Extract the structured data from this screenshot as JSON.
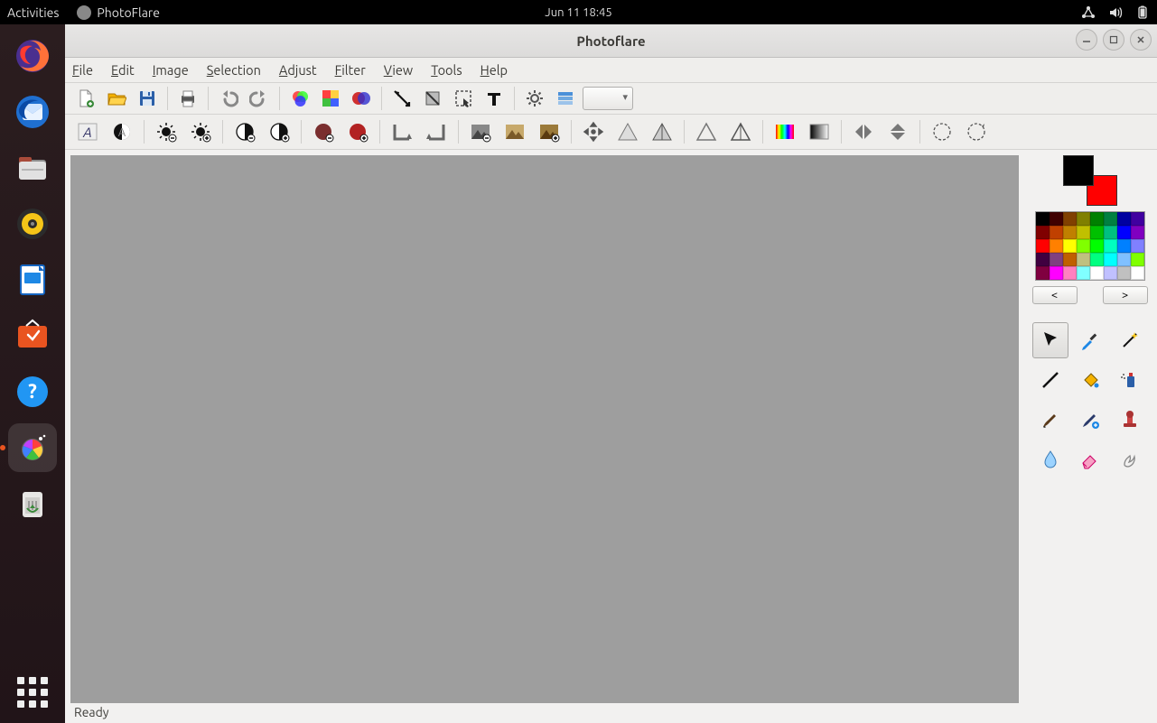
{
  "topbar": {
    "activities": "Activities",
    "app_name": "PhotoFlare",
    "clock": "Jun 11  18:45"
  },
  "window": {
    "title": "Photoflare"
  },
  "menu": {
    "file": "File",
    "edit": "Edit",
    "image": "Image",
    "selection": "Selection",
    "adjust": "Adjust",
    "filter": "Filter",
    "view": "View",
    "tools": "Tools",
    "help": "Help"
  },
  "palette_nav": {
    "prev": "<",
    "next": ">"
  },
  "palette_colors": [
    "#000000",
    "#400000",
    "#804000",
    "#808000",
    "#008000",
    "#008040",
    "#0000a0",
    "#4000a0",
    "#800000",
    "#c04000",
    "#c08000",
    "#c0c000",
    "#00c000",
    "#00c080",
    "#0000ff",
    "#8000c0",
    "#ff0000",
    "#ff8000",
    "#ffff00",
    "#80ff00",
    "#00ff00",
    "#00ffc0",
    "#0080ff",
    "#8080ff",
    "#400040",
    "#804080",
    "#c06000",
    "#c0c080",
    "#00ff80",
    "#00ffff",
    "#80c0ff",
    "#80ff00",
    "#800040",
    "#ff00ff",
    "#ff80c0",
    "#80ffff",
    "#ffffff",
    "#c0c0ff",
    "#c0c0c0",
    "#ffffff"
  ],
  "status": "Ready",
  "tools": {
    "pointer": "pointer",
    "picker": "picker",
    "wand": "wand",
    "line": "line",
    "fill": "fill",
    "spray": "spray",
    "brush": "brush",
    "advbrush": "advbrush",
    "stamp": "stamp",
    "blur": "blur",
    "eraser": "eraser",
    "smudge": "smudge"
  }
}
